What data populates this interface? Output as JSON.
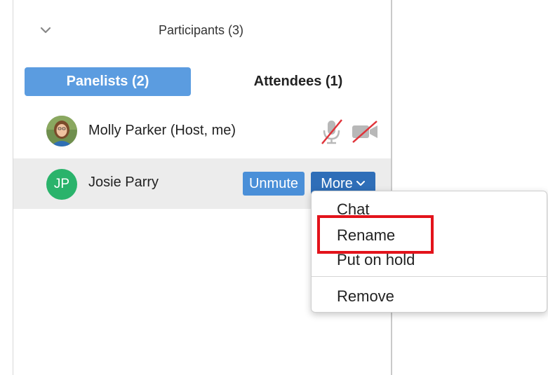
{
  "panel": {
    "title": "Participants (3)",
    "collapse_icon": "chevron-down-icon"
  },
  "tabs": [
    {
      "label": "Panelists (2)",
      "active": true
    },
    {
      "label": "Attendees (1)",
      "active": false
    }
  ],
  "participants": [
    {
      "name": "Molly Parker (Host, me)",
      "avatar": "photo",
      "icons": [
        "muted-mic-icon",
        "video-off-icon"
      ]
    },
    {
      "name": "Josie Parry",
      "initials": "JP",
      "avatar_color": "#2ab36b",
      "unmute_label": "Unmute",
      "more_label": "More"
    }
  ],
  "more_menu": {
    "items": [
      "Chat",
      "Rename",
      "Put on hold",
      "Remove"
    ],
    "highlighted": "Rename"
  },
  "colors": {
    "accent": "#5b9ce0",
    "more_button": "#2f6eb8",
    "highlight": "#e3131b",
    "muted_slash": "#e0333a"
  }
}
